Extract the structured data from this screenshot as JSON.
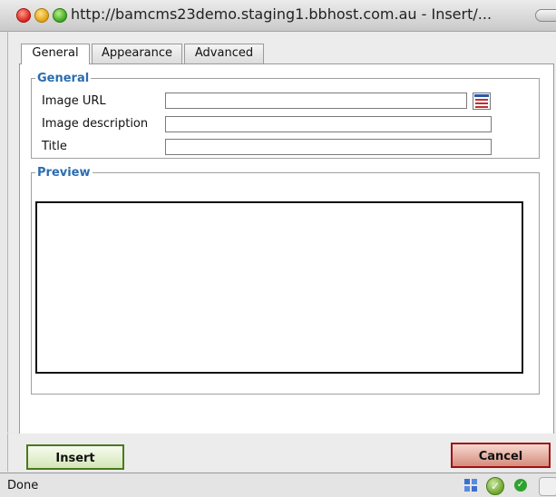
{
  "window": {
    "title": "http://bamcms23demo.staging1.bbhost.com.au - Insert/..."
  },
  "tabs": [
    {
      "label": "General",
      "active": true
    },
    {
      "label": "Appearance",
      "active": false
    },
    {
      "label": "Advanced",
      "active": false
    }
  ],
  "general_section": {
    "legend": "General",
    "fields": [
      {
        "label": "Image URL",
        "value": ""
      },
      {
        "label": "Image description",
        "value": ""
      },
      {
        "label": "Title",
        "value": ""
      }
    ]
  },
  "preview_section": {
    "legend": "Preview"
  },
  "buttons": {
    "insert": "Insert",
    "cancel": "Cancel"
  },
  "status": {
    "text": "Done"
  },
  "colors": {
    "legend": "#2b6cb0",
    "insert_border": "#4a7a1a",
    "cancel_border": "#a01010"
  }
}
